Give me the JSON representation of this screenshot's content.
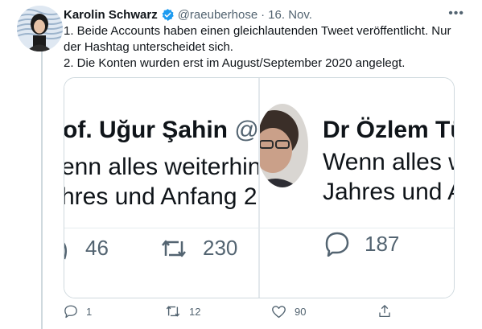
{
  "tweet": {
    "author_name": "Karolin Schwarz",
    "handle": "@raeuberhose",
    "separator": "·",
    "date": "16. Nov.",
    "more": "•••",
    "text_lines": [
      "1. Beide Accounts haben einen gleichlautenden Tweet veröffentlicht. Nur der Hashtag unterscheidet sich.",
      "2. Die Konten wurden erst im August/September 2020 angelegt."
    ],
    "replies": "1",
    "retweets": "12",
    "likes": "90"
  },
  "media": {
    "left": {
      "name": "of. Uğur Şahin",
      "handle": "@F",
      "line1": "enn alles weiterhin",
      "line2": "hres und Anfang 2",
      "retweets": "230",
      "first_stat": "46"
    },
    "right": {
      "name": "Dr Özlem Tü",
      "line1": "Wenn alles w",
      "line2": "Jahres und A",
      "replies": "187"
    }
  },
  "colors": {
    "text": "#0f1419",
    "muted": "#536471",
    "verified": "#1d9bf0",
    "border": "#cfd9de"
  }
}
